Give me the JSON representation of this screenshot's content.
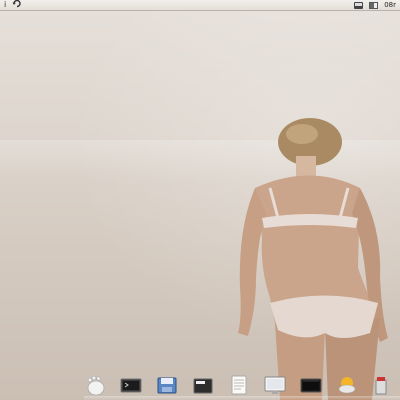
{
  "menubar": {
    "left_items": [
      {
        "label": "i",
        "icon": "info-icon"
      },
      {
        "label": "",
        "icon": "refresh-icon"
      }
    ],
    "tray": [
      {
        "icon": "network-icon"
      },
      {
        "icon": "battery-icon"
      }
    ],
    "clock": "08r"
  },
  "dock": {
    "items": [
      {
        "icon": "gnome-foot-icon"
      },
      {
        "icon": "terminal-icon"
      },
      {
        "icon": "file-manager-icon"
      },
      {
        "icon": "window-app-icon"
      },
      {
        "icon": "text-editor-icon"
      },
      {
        "icon": "monitor-icon"
      },
      {
        "icon": "screen-icon"
      },
      {
        "icon": "weather-icon"
      },
      {
        "icon": "package-icon"
      }
    ]
  }
}
